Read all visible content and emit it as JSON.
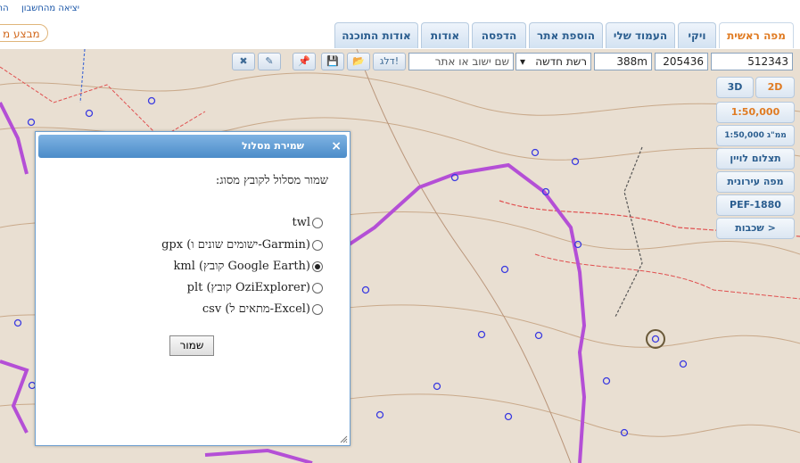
{
  "topbar": {
    "logout": "יציאה מהחשבון",
    "connect": "התח"
  },
  "top_button": "מבצע מ",
  "tabs": [
    {
      "label": "מפה ראשית"
    },
    {
      "label": "ויקי"
    },
    {
      "label": "העמוד שלי"
    },
    {
      "label": "הוספת אתר"
    },
    {
      "label": "הדפסה"
    },
    {
      "label": "אודות"
    },
    {
      "label": "אודות התוכנה"
    }
  ],
  "toolbar": {
    "coord_y": "512343",
    "coord_x": "205436",
    "elevation": "388m",
    "grid_select": "רשת חדשה",
    "search_placeholder": "שם ישוב או אתר",
    "skip_button": "דלג!"
  },
  "sidebar": {
    "mode_3d": "3D",
    "mode_2d": "2D",
    "scale": "1:50,000",
    "scale_mm": "1:50,000 ממ\"ג",
    "satellite": "תצלום לויין",
    "city_map": "מפה עירונית",
    "pef": "PEF-1880",
    "layers": "שכבות >"
  },
  "dialog": {
    "title": "שמירת מסלול",
    "close": "×",
    "prompt": "שמור מסלול לקובץ מסוג:",
    "options": [
      {
        "label": "twl",
        "selected": false
      },
      {
        "label": "gpx (ישומים שונים ו-Garmin)",
        "selected": false
      },
      {
        "label": "kml (קובץ Google Earth)",
        "selected": true
      },
      {
        "label": "plt (קובץ OziExplorer)",
        "selected": false
      },
      {
        "label": "csv (מתאים ל-Excel)",
        "selected": false
      }
    ],
    "save_button": "שמור"
  },
  "colors": {
    "tab_active": "#e07b22",
    "tab_text": "#2a5d8f",
    "dialog_header": "#4b8cc9",
    "route": "#b44fd6"
  }
}
